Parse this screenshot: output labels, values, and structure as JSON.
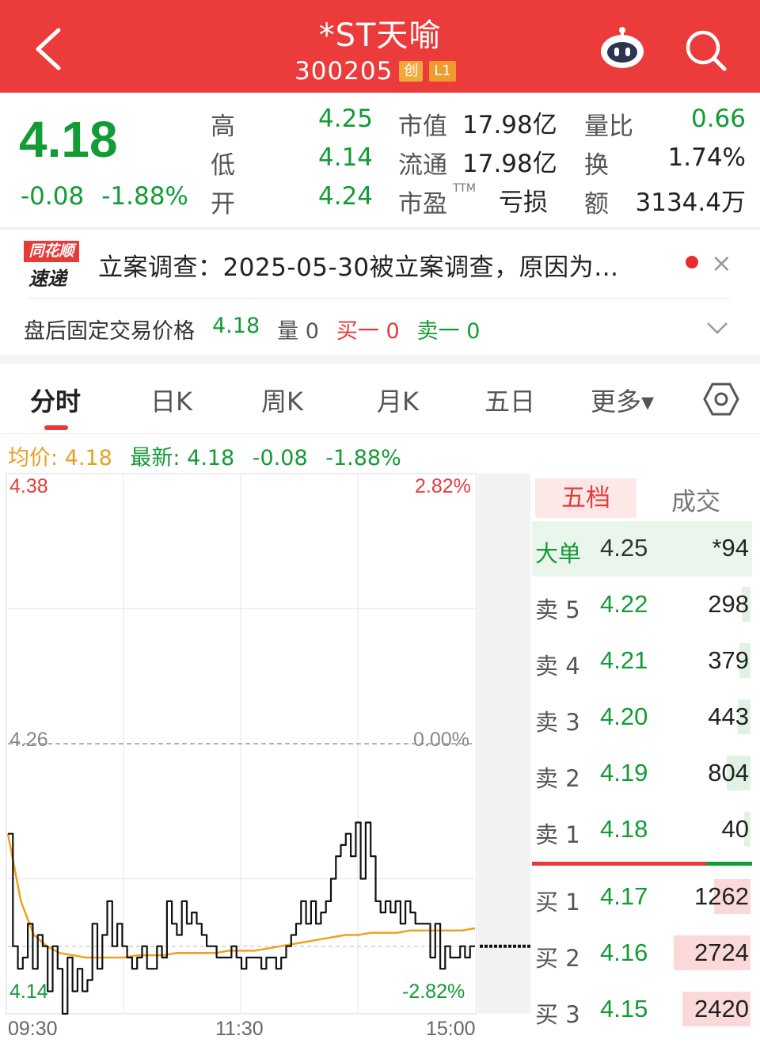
{
  "header": {
    "title": "*ST天喻",
    "code": "300205",
    "badge_board": "创",
    "badge_level": "L1",
    "icons": [
      "back-arrow-icon",
      "robot-assistant-icon",
      "search-icon"
    ]
  },
  "quote": {
    "price": "4.18",
    "change": "-0.08",
    "change_pct": "-1.88%",
    "high_label": "高",
    "high": "4.25",
    "low_label": "低",
    "low": "4.14",
    "open_label": "开",
    "open": "4.24",
    "mktcap_label": "市值",
    "mktcap": "17.98亿",
    "float_label": "流通",
    "float_cap": "17.98亿",
    "pe_label": "市盈",
    "pe_sup": "TTM",
    "pe": "亏损",
    "vol_ratio_label": "量比",
    "vol_ratio": "0.66",
    "turnover_label": "换",
    "turnover": "1.74%",
    "amount_label": "额",
    "amount": "3134.4万"
  },
  "news": {
    "logo_top": "同花顺",
    "logo_bottom": "速递",
    "text": "立案调查：2025-05-30被立案调查，原因为…",
    "close": "×"
  },
  "after_hours": {
    "label": "盘后固定交易价格",
    "price": "4.18",
    "vol_label": "量 0",
    "buy1_label": "买一 0",
    "sell1_label": "卖一 0"
  },
  "tabs": [
    "分时",
    "日K",
    "周K",
    "月K",
    "五日",
    "更多▾"
  ],
  "info_line": {
    "avg": "均价: 4.18",
    "latest": "最新: 4.18",
    "chg": "-0.08",
    "pct": "-1.88%"
  },
  "chart_axis": {
    "y_top": "4.38",
    "y_mid": "4.26",
    "y_bot": "4.14",
    "pct_top": "2.82%",
    "pct_mid": "0.00%",
    "pct_bot": "-2.82%",
    "x_start": "09:30",
    "x_mid": "11:30",
    "x_end": "15:00"
  },
  "colors": {
    "header_red": "#ec3b3b",
    "down_green": "#139b35",
    "up_red": "#e93a3a",
    "avg_orange": "#f0a020"
  },
  "chart_data": {
    "type": "line",
    "title": "",
    "ylim": [
      4.14,
      4.38
    ],
    "prev_close": 4.26,
    "x": [
      "09:30",
      "11:30",
      "15:00"
    ],
    "series": [
      {
        "name": "最新",
        "values": [
          4.22,
          4.17,
          4.16,
          4.165,
          4.18,
          4.16,
          4.175,
          4.17,
          4.15,
          4.17,
          4.16,
          4.14,
          4.165,
          4.15,
          4.16,
          4.15,
          4.155,
          4.18,
          4.16,
          4.175,
          4.19,
          4.17,
          4.18,
          4.17,
          4.165,
          4.16,
          4.165,
          4.17,
          4.16,
          4.16,
          4.17,
          4.165,
          4.19,
          4.18,
          4.175,
          4.19,
          4.18,
          4.185,
          4.18,
          4.175,
          4.17,
          4.17,
          4.165,
          4.165,
          4.165,
          4.17,
          4.165,
          4.16,
          4.165,
          4.165,
          4.165,
          4.16,
          4.165,
          4.165,
          4.16,
          4.165,
          4.17,
          4.175,
          4.18,
          4.19,
          4.18,
          4.19,
          4.18,
          4.185,
          4.19,
          4.2,
          4.21,
          4.215,
          4.22,
          4.21,
          4.225,
          4.2,
          4.225,
          4.21,
          4.19,
          4.185,
          4.19,
          4.185,
          4.19,
          4.18,
          4.19,
          4.185,
          4.18,
          4.18,
          4.18,
          4.165,
          4.18,
          4.16,
          4.17,
          4.165,
          4.165,
          4.17,
          4.165,
          4.17,
          4.17
        ]
      },
      {
        "name": "均价",
        "values": [
          4.22,
          4.19,
          4.175,
          4.17,
          4.167,
          4.166,
          4.165,
          4.165,
          4.165,
          4.165,
          4.166,
          4.166,
          4.166,
          4.167,
          4.167,
          4.167,
          4.167,
          4.168,
          4.168,
          4.168,
          4.169,
          4.17,
          4.171,
          4.172,
          4.173,
          4.174,
          4.175,
          4.175,
          4.176,
          4.176,
          4.176,
          4.177,
          4.177,
          4.177,
          4.177,
          4.177,
          4.178
        ]
      }
    ]
  },
  "order_book": {
    "tab_active": "五档",
    "tab_other": "成交",
    "big_order": {
      "label": "大单",
      "price": "4.25",
      "vol": "*94"
    },
    "asks": [
      {
        "label": "卖 5",
        "price": "4.22",
        "vol": "298",
        "share": 0.04
      },
      {
        "label": "卖 4",
        "price": "4.21",
        "vol": "379",
        "share": 0.05
      },
      {
        "label": "卖 3",
        "price": "4.20",
        "vol": "443",
        "share": 0.06
      },
      {
        "label": "卖 2",
        "price": "4.19",
        "vol": "804",
        "share": 0.11
      },
      {
        "label": "卖 1",
        "price": "4.18",
        "vol": "40",
        "share": 0.01
      }
    ],
    "bids": [
      {
        "label": "买 1",
        "price": "4.17",
        "vol": "1262",
        "share": 0.17
      },
      {
        "label": "买 2",
        "price": "4.16",
        "vol": "2724",
        "share": 0.36
      },
      {
        "label": "买 3",
        "price": "4.15",
        "vol": "2420",
        "share": 0.32
      }
    ],
    "buy_sell_ratio": 0.79
  }
}
